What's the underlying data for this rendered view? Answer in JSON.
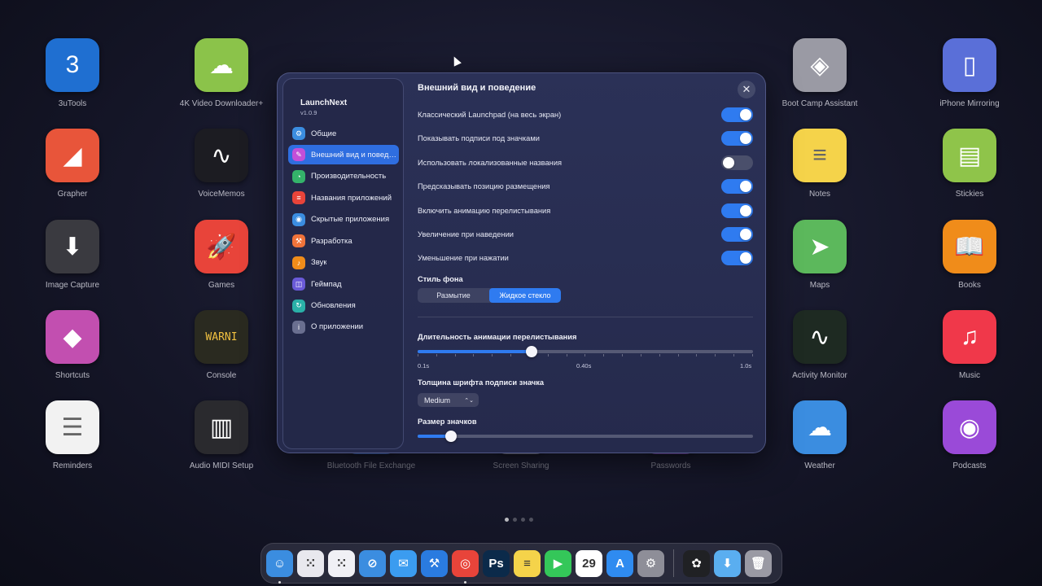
{
  "launchpad": {
    "apps": [
      {
        "label": "3uTools",
        "icon": "3utools-icon",
        "color": "#1f6fd1",
        "glyph": "3"
      },
      {
        "label": "4K Video Downloader+",
        "icon": "cloud-download-icon",
        "color": "#8bc34a",
        "glyph": "☁"
      },
      {
        "label": "Boot Camp Assistant",
        "icon": "bootcamp-icon",
        "color": "#9a9aa4",
        "glyph": "◈"
      },
      {
        "label": "iPhone Mirroring",
        "icon": "iphone-icon",
        "color": "#5a6fd8",
        "glyph": "▯"
      },
      {
        "label": "Grapher",
        "icon": "grapher-icon",
        "color": "#e8553a",
        "glyph": "◢"
      },
      {
        "label": "VoiceMemos",
        "icon": "waveform-icon",
        "color": "#1c1c22",
        "glyph": "∿"
      },
      {
        "label": "Notes",
        "icon": "notes-icon",
        "color": "#f5d34a",
        "glyph": "≡"
      },
      {
        "label": "Stickies",
        "icon": "stickies-icon",
        "color": "#8fc44a",
        "glyph": "▤"
      },
      {
        "label": "Image Capture",
        "icon": "image-capture-icon",
        "color": "#3a3a40",
        "glyph": "⬇"
      },
      {
        "label": "Games",
        "icon": "rocket-icon",
        "color": "#e8443a",
        "glyph": "🚀"
      },
      {
        "label": "Maps",
        "icon": "maps-icon",
        "color": "#5cb85c",
        "glyph": "➤"
      },
      {
        "label": "Books",
        "icon": "books-icon",
        "color": "#f08c1a",
        "glyph": "📖"
      },
      {
        "label": "Shortcuts",
        "icon": "shortcuts-icon",
        "color": "#c24fb0",
        "glyph": "◆"
      },
      {
        "label": "Console",
        "icon": "console-icon",
        "color": "#2a2a20",
        "glyph": "WARNI"
      },
      {
        "label": "Activity Monitor",
        "icon": "activity-monitor-icon",
        "color": "#1e2a22",
        "glyph": "∿"
      },
      {
        "label": "Music",
        "icon": "music-icon",
        "color": "#f0384a",
        "glyph": "♫"
      },
      {
        "label": "Reminders",
        "icon": "reminders-icon",
        "color": "#f2f2f2",
        "glyph": "☰"
      },
      {
        "label": "Audio MIDI Setup",
        "icon": "midi-keyboard-icon",
        "color": "#2a2a2e",
        "glyph": "▥"
      },
      {
        "label": "Bluetooth File Exchange",
        "icon": "bluetooth-icon",
        "color": "#3a6fd8",
        "glyph": "ᛒ"
      },
      {
        "label": "Screen Sharing",
        "icon": "screen-sharing-icon",
        "color": "#9a9aa4",
        "glyph": "➜"
      },
      {
        "label": "Passwords",
        "icon": "passwords-icon",
        "color": "#8f4ac8",
        "glyph": "!"
      },
      {
        "label": "Weather",
        "icon": "weather-icon",
        "color": "#3b8de0",
        "glyph": "☁"
      },
      {
        "label": "Podcasts",
        "icon": "podcasts-icon",
        "color": "#9a4ad8",
        "glyph": "◉"
      }
    ]
  },
  "window": {
    "app_name": "LaunchNext",
    "version": "v1.0.9",
    "title": "Внешний вид и поведение",
    "close_glyph": "✕",
    "sidebar": [
      {
        "label": "Общие",
        "icon": "gear-icon",
        "color": "#3b8de0",
        "glyph": "⚙"
      },
      {
        "label": "Внешний вид и поведение",
        "icon": "brush-icon",
        "color": "#c24fd8",
        "glyph": "✎",
        "selected": true
      },
      {
        "label": "Производительность",
        "icon": "gauge-icon",
        "color": "#34b36a",
        "glyph": "◔"
      },
      {
        "label": "Названия приложений",
        "icon": "text-icon",
        "color": "#e8443a",
        "glyph": "≡"
      },
      {
        "label": "Скрытые приложения",
        "icon": "eye-icon",
        "color": "#3b8de0",
        "glyph": "◉"
      },
      {
        "label": "Разработка",
        "icon": "hammer-icon",
        "color": "#f0733a",
        "glyph": "⚒"
      },
      {
        "label": "Звук",
        "icon": "speaker-icon",
        "color": "#f08c1a",
        "glyph": "♪"
      },
      {
        "label": "Геймпад",
        "icon": "gamepad-icon",
        "color": "#6a5ad8",
        "glyph": "◫"
      },
      {
        "label": "Обновления",
        "icon": "refresh-icon",
        "color": "#2ab0a8",
        "glyph": "↻"
      },
      {
        "label": "О приложении",
        "icon": "info-icon",
        "color": "#6a6f90",
        "glyph": "i"
      }
    ],
    "toggles": [
      {
        "label": "Классический Launchpad (на весь экран)",
        "on": true
      },
      {
        "label": "Показывать подписи под значками",
        "on": true
      },
      {
        "label": "Использовать локализованные названия",
        "on": false
      },
      {
        "label": "Предсказывать позицию размещения",
        "on": true
      },
      {
        "label": "Включить анимацию перелистывания",
        "on": true
      },
      {
        "label": "Увеличение при наведении",
        "on": true
      },
      {
        "label": "Уменьшение при нажатии",
        "on": true
      }
    ],
    "background_style": {
      "label": "Стиль фона",
      "options": [
        "Размытие",
        "Жидкое стекло"
      ],
      "selected": "Жидкое стекло"
    },
    "animation_duration": {
      "label": "Длительность анимации перелистывания",
      "min_label": "0.1s",
      "mid_label": "0.40s",
      "max_label": "1.0s",
      "value_fraction": 0.34
    },
    "font_weight": {
      "label": "Толщина шрифта подписи значка",
      "value": "Medium",
      "chevron": "⌃⌄"
    },
    "icon_size": {
      "label": "Размер значков",
      "value_fraction": 0.1
    }
  },
  "dock": {
    "items": [
      {
        "name": "finder-icon",
        "color": "#3b8de0",
        "glyph": "☺",
        "running": true
      },
      {
        "name": "launchpad-icon",
        "color": "#e8e8ee",
        "glyph": "⁙"
      },
      {
        "name": "launchnext-icon",
        "color": "#f0f0f5",
        "glyph": "⁙"
      },
      {
        "name": "safari-icon",
        "color": "#3b8de0",
        "glyph": "⊘"
      },
      {
        "name": "mail-icon",
        "color": "#3b9cf0",
        "glyph": "✉"
      },
      {
        "name": "xcode-icon",
        "color": "#2a7be0",
        "glyph": "⚒"
      },
      {
        "name": "chrome-icon",
        "color": "#e8443a",
        "glyph": "◎",
        "running": true
      },
      {
        "name": "photoshop-icon",
        "color": "#0b2a4a",
        "glyph": "Ps"
      },
      {
        "name": "notes-icon",
        "color": "#f5d34a",
        "glyph": "≡"
      },
      {
        "name": "facetime-icon",
        "color": "#34c759",
        "glyph": "▶"
      },
      {
        "name": "calendar-icon",
        "color": "#ffffff",
        "glyph": "29"
      },
      {
        "name": "app-store-icon",
        "color": "#2f8bf0",
        "glyph": "A"
      },
      {
        "name": "system-settings-icon",
        "color": "#8e8e98",
        "glyph": "⚙"
      },
      {
        "name": "chatgpt-icon",
        "color": "#202124",
        "glyph": "✿"
      },
      {
        "name": "downloads-folder-icon",
        "color": "#5aaef0",
        "glyph": "⬇"
      },
      {
        "name": "trash-icon",
        "color": "#9a9aa4",
        "glyph": "🗑"
      }
    ]
  }
}
